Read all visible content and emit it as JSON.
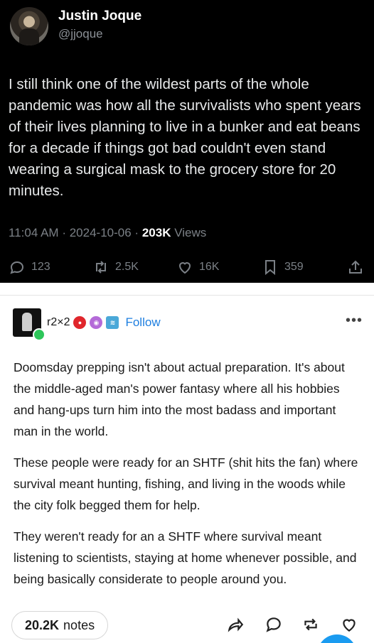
{
  "tweet": {
    "author_name": "Justin Joque",
    "author_handle": "@jjoque",
    "text": "I still think one of the wildest parts of the whole pandemic was how all the survivalists who spent years of their lives planning to live in a bunker and eat beans for a decade if things got bad couldn't even stand wearing a surgical mask to the grocery store for 20 minutes.",
    "time": "11:04 AM",
    "date": "2024-10-06",
    "separator": "·",
    "views_count": "203K",
    "views_label": "Views",
    "replies": "123",
    "retweets": "2.5K",
    "likes": "16K",
    "bookmarks": "359",
    "icons": [
      "reply-icon",
      "retweet-icon",
      "like-icon",
      "bookmark-icon",
      "share-icon"
    ]
  },
  "post": {
    "username": "r2×2",
    "follow_label": "Follow",
    "more_label": "•••",
    "paragraphs": [
      "Doomsday prepping isn't about actual preparation. It's about the middle-aged man's power fantasy where all his hobbies and hang-ups turn him into the most badass and important man in the world.",
      "These people were ready for an SHTF (shit hits the fan) where survival meant hunting, fishing, and living in the woods while the city folk begged them for help.",
      "They weren't ready for an a SHTF where survival meant listening to scientists, staying at home whenever possible, and being basically considerate to people around you."
    ],
    "notes_count": "20.2K",
    "notes_label": "notes",
    "icons": [
      "share-arrow-icon",
      "comment-icon",
      "reblog-icon",
      "heart-icon"
    ]
  },
  "colors": {
    "tweet_bg": "#000000",
    "tweet_text": "#e7e9ea",
    "tweet_muted": "#7b8086",
    "tumblr_follow": "#1f7fe0",
    "tumblr_text": "#1a1a1a"
  }
}
